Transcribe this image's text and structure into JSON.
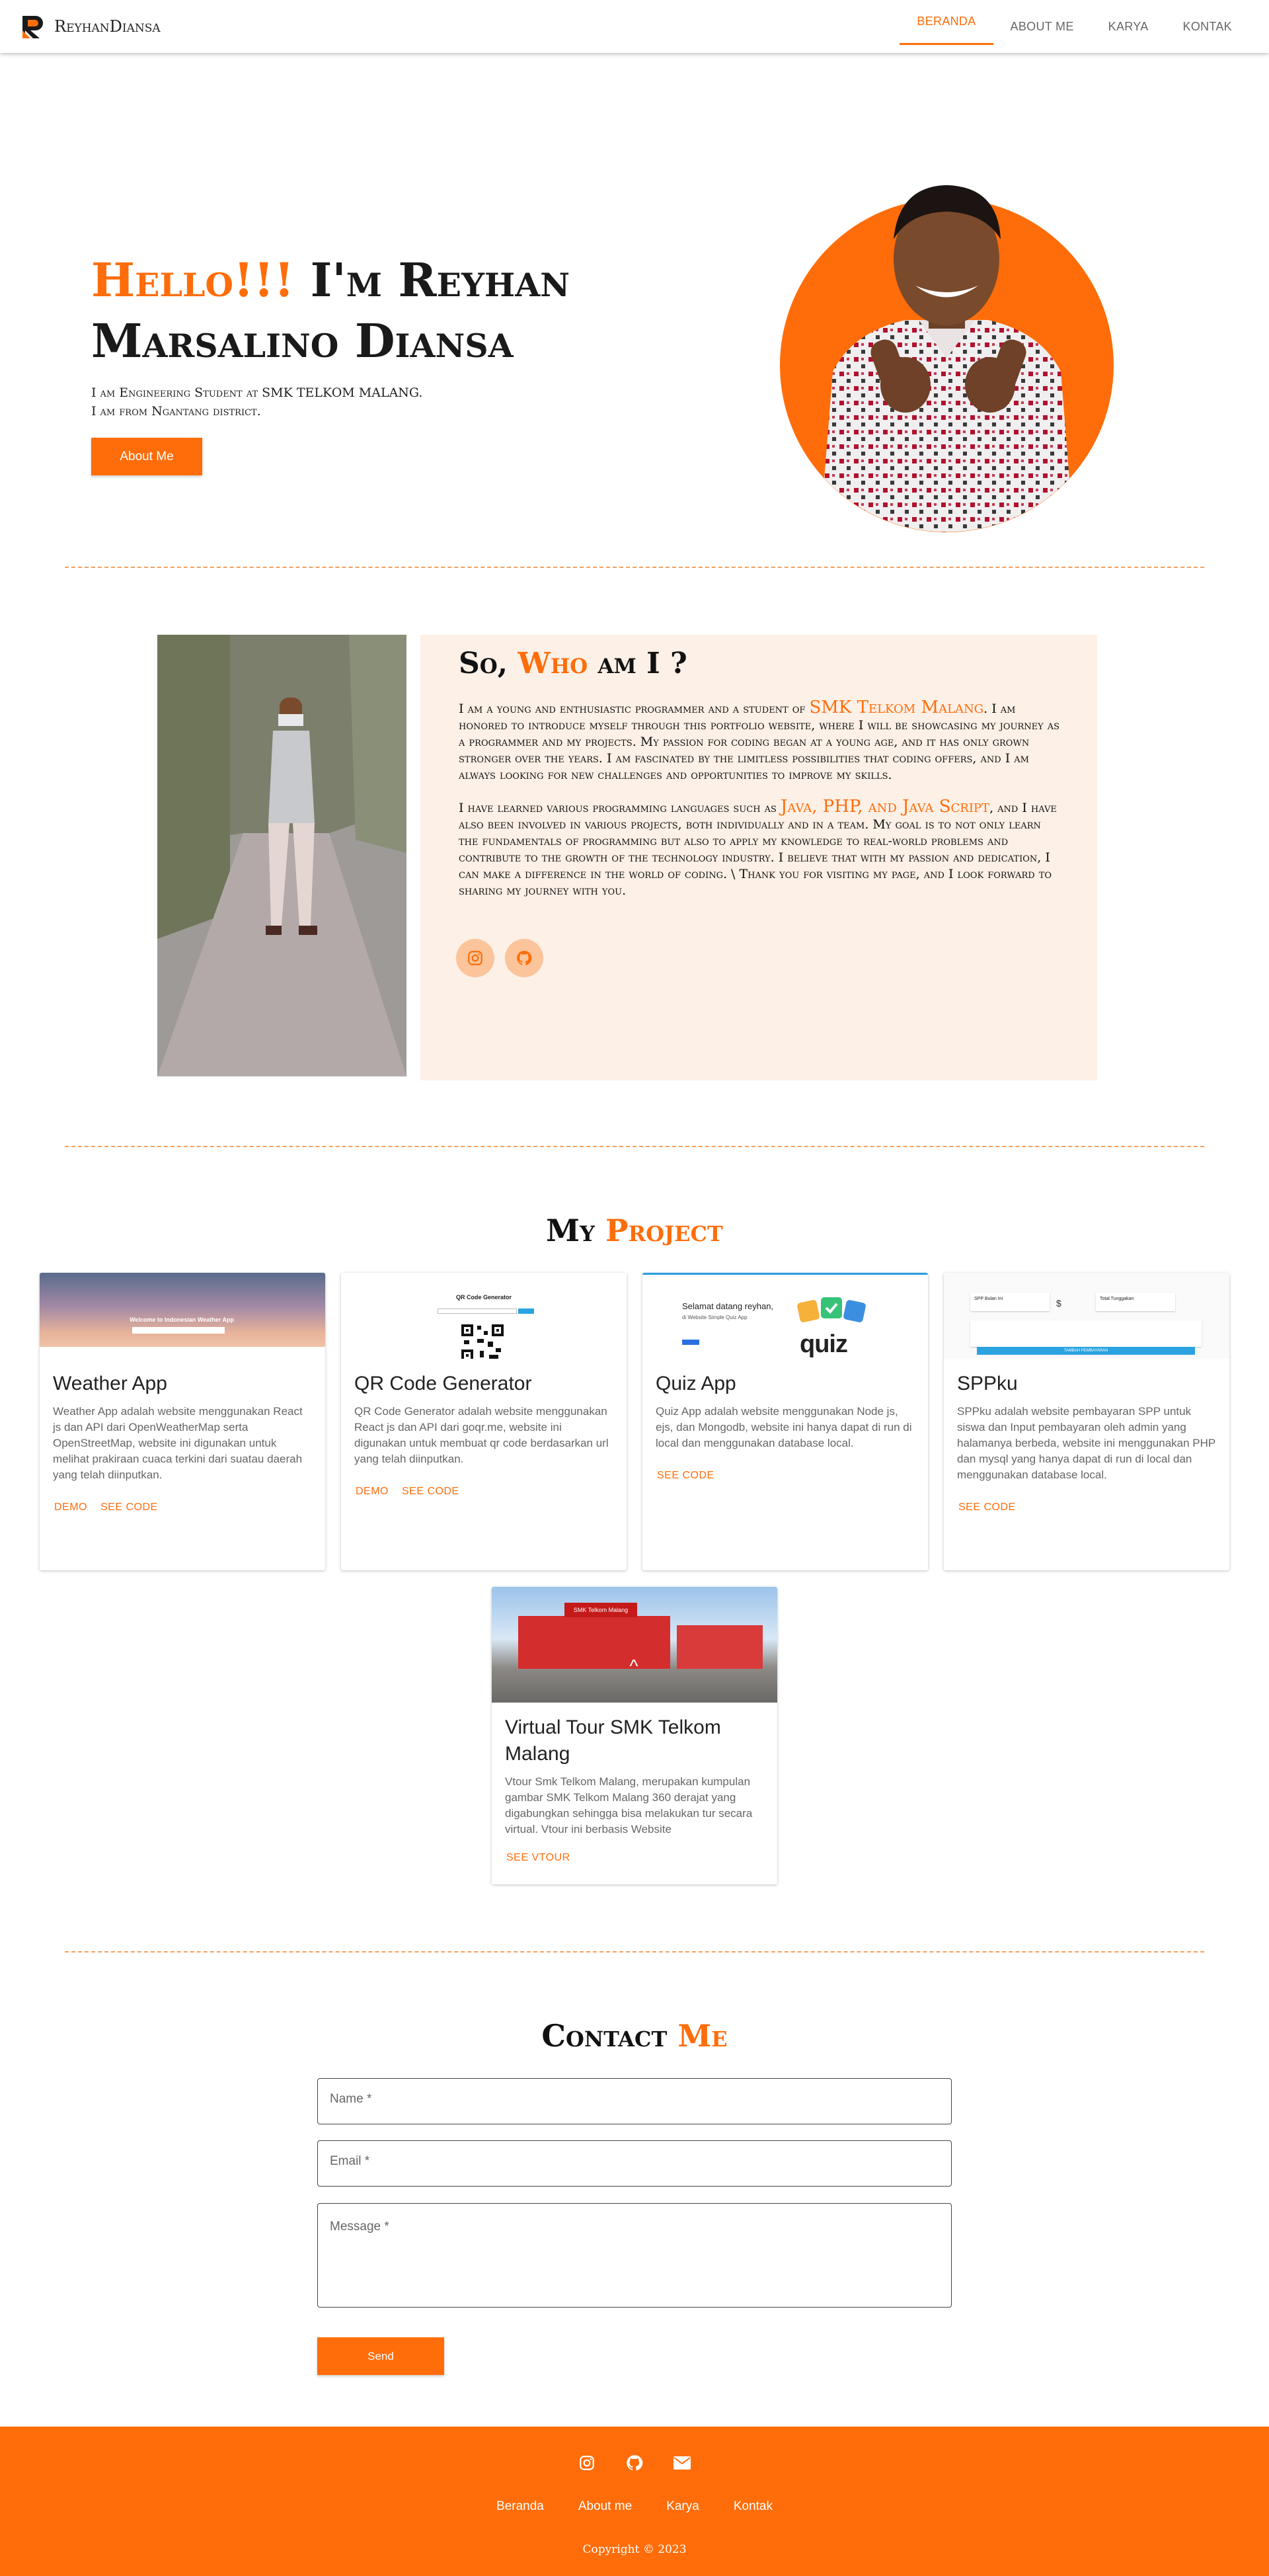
{
  "brand": {
    "name": "ReyhanDiansa",
    "accent": "#ff6d0a"
  },
  "nav": {
    "items": [
      {
        "label": "BERANDA"
      },
      {
        "label": "ABOUT ME"
      },
      {
        "label": "KARYA"
      },
      {
        "label": "KONTAK"
      }
    ]
  },
  "hero": {
    "greeting": "Hello!!!",
    "name": " I'm Reyhan Marsalino Diansa",
    "line1": "I am Engineering Student at SMK TELKOM MALANG.",
    "line2": "I am from Ngantang district.",
    "button": "About Me"
  },
  "about": {
    "title_prefix": "So, ",
    "title_highlight": "Who",
    "title_suffix": " am I ?",
    "p1_before": "I am a young and enthusiastic programmer and a student of ",
    "p1_highlight": "SMK Telkom Malang",
    "p1_after": ". I am honored to introduce myself through this portfolio website, where I will be showcasing my journey as a programmer and my projects. My passion for coding began at a young age, and it has only grown stronger over the years. I am fascinated by the limitless possibilities that coding offers, and I am always looking for new challenges and opportunities to improve my skills.",
    "p2_before": "I have learned various programming languages such as ",
    "p2_highlight": "Java, PHP, and Java Script",
    "p2_after": ", and I have also been involved in various projects, both individually and in a team. My goal is to not only learn the fundamentals of programming but also to apply my knowledge to real-world problems and contribute to the growth of the technology industry. I believe that with my passion and dedication, I can make a difference in the world of coding. \\ Thank you for visiting my page, and I look forward to sharing my journey with you."
  },
  "projects": {
    "title_prefix": "My ",
    "title_highlight": "Project",
    "items": [
      {
        "title": "Weather App",
        "desc": "Weather App adalah website menggunakan React js dan API dari OpenWeatherMap serta OpenStreetMap, website ini digunakan untuk melihat prakiraan cuaca terkini dari suatau daerah yang telah diinputkan.",
        "actions": [
          "DEMO",
          "SEE CODE"
        ]
      },
      {
        "title": "QR Code Generator",
        "desc": "QR Code Generator adalah website menggunakan React js dan API dari goqr.me, website ini digunakan untuk membuat qr code berdasarkan url yang telah diinputkan.",
        "actions": [
          "DEMO",
          "SEE CODE"
        ]
      },
      {
        "title": "Quiz App",
        "desc": "Quiz App adalah website menggunakan Node js, ejs, dan Mongodb, website ini hanya dapat di run di local dan menggunakan database local.",
        "actions": [
          "SEE CODE"
        ]
      },
      {
        "title": "SPPku",
        "desc": "SPPku adalah website pembayaran SPP untuk siswa dan Input pembayaran oleh admin yang halamanya berbeda, website ini menggunakan PHP dan mysql yang hanya dapat di run di local dan menggunakan database local.",
        "actions": [
          "SEE CODE"
        ]
      },
      {
        "title": "Virtual Tour SMK Telkom Malang",
        "desc": "Vtour Smk Telkom Malang, merupakan kumpulan gambar SMK Telkom Malang 360 derajat yang digabungkan sehingga bisa melakukan tur secara virtual. Vtour ini berbasis Website",
        "actions": [
          "SEE VTOUR"
        ]
      }
    ],
    "thumbs": {
      "weather_heading": "Welcome to Indonesian Weather App",
      "qr_heading": "QR Code Generator",
      "quiz_line1": "Selamat datang reyhan,",
      "quiz_line2": "di Website Simple Quiz App",
      "quiz_logo": "quiz",
      "sppku_stat1": "SPP Bulan Ini",
      "sppku_stat2": "Total Tunggakan",
      "sppku_button": "TAMBAH PEMBAYARAN",
      "vtour_sign": "SMK Telkom Malang"
    }
  },
  "contact": {
    "title_prefix": "Contact ",
    "title_highlight": "Me",
    "name_label": "Name *",
    "email_label": "Email *",
    "message_label": "Message *",
    "send": "Send"
  },
  "footer": {
    "icons": [
      "instagram-icon",
      "github-icon",
      "email-icon"
    ],
    "links": [
      "Beranda",
      "About me",
      "Karya",
      "Kontak"
    ],
    "copyright": "Copyright © 2023"
  }
}
